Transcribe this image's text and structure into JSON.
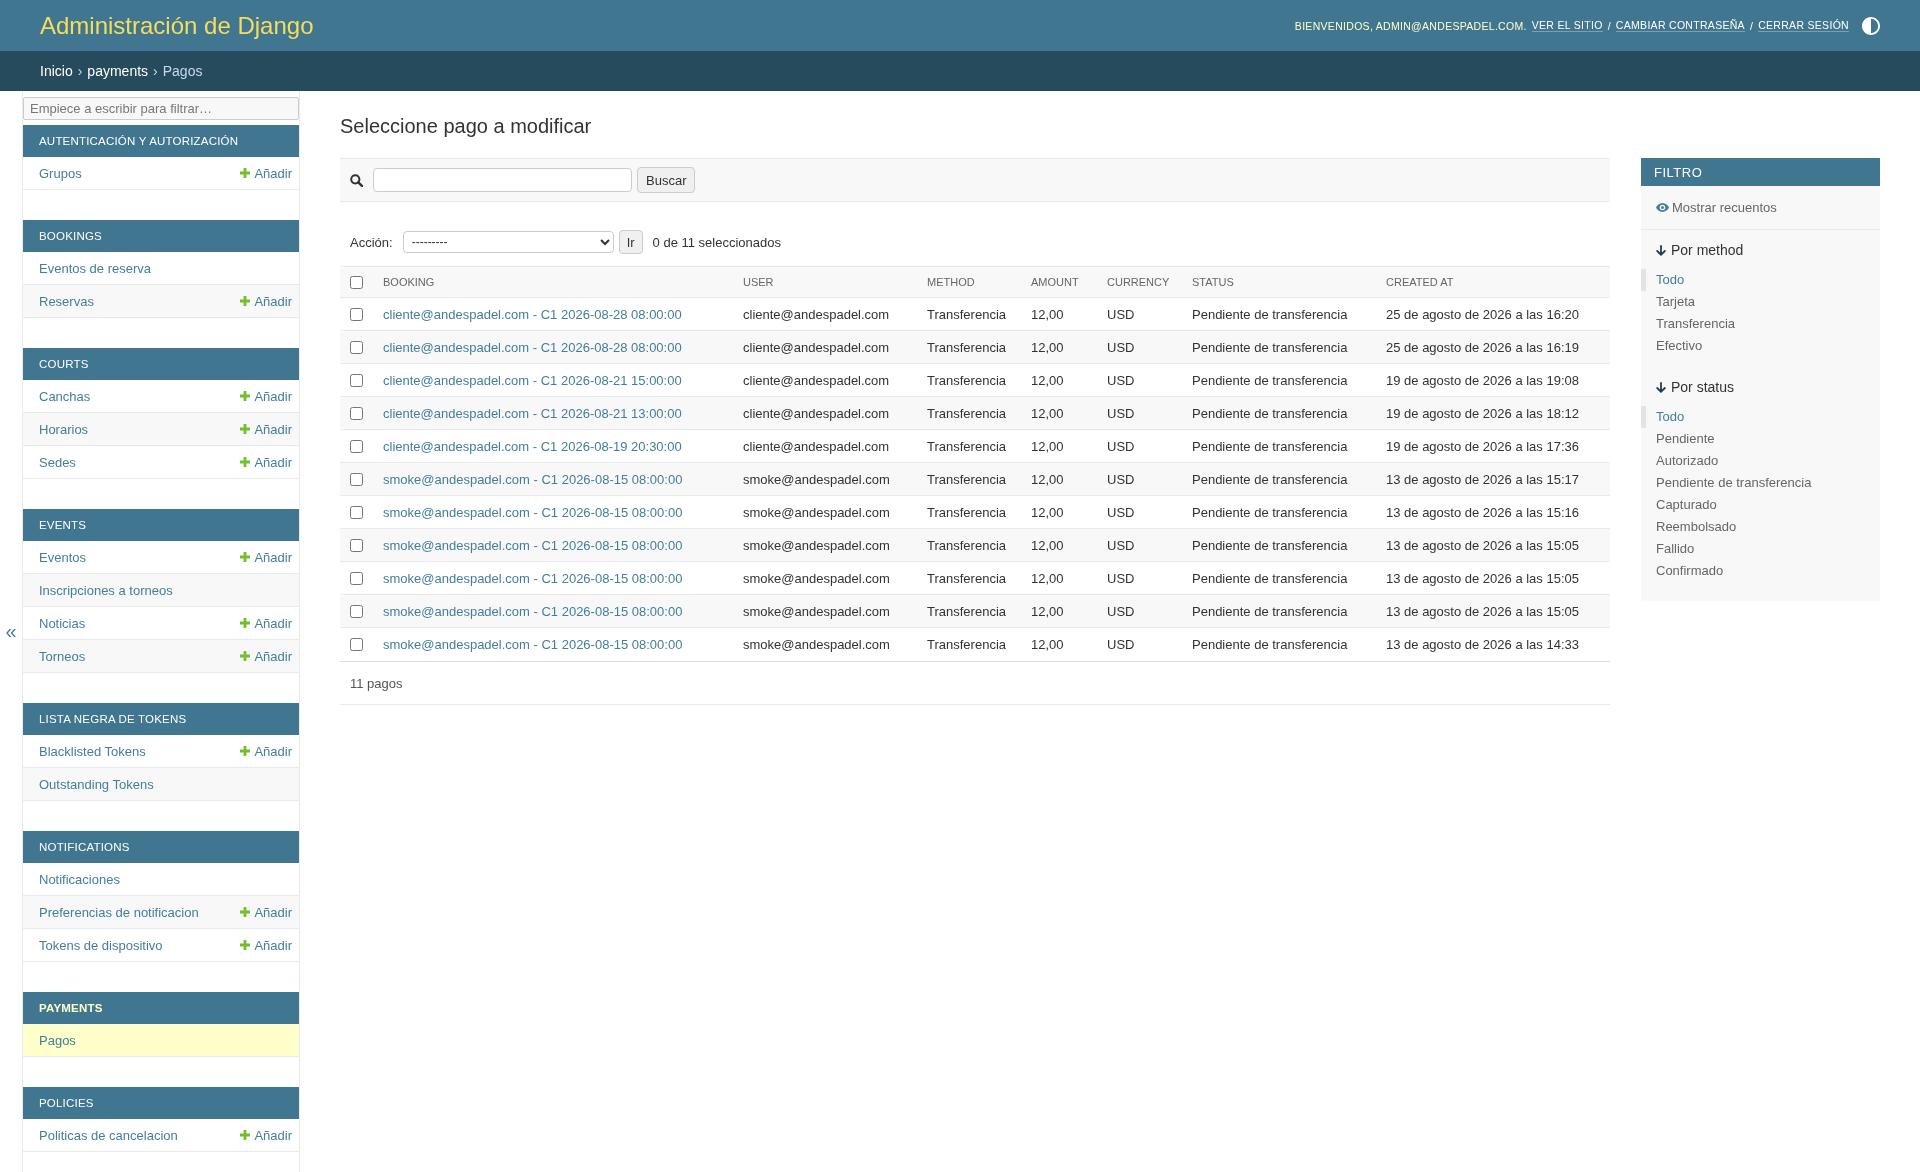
{
  "header": {
    "branding": "Administración de Django",
    "user_tools": [
      {
        "kind": "text",
        "text": "BIENVENIDOS, ADMIN@ANDESPADEL.COM."
      },
      {
        "kind": "link",
        "text": "VER EL SITIO"
      },
      {
        "kind": "separator",
        "text": "/"
      },
      {
        "kind": "link",
        "text": "CAMBIAR CONTRASEÑA"
      },
      {
        "kind": "separator",
        "text": "/"
      },
      {
        "kind": "link",
        "text": "CERRAR SESIÓN"
      }
    ]
  },
  "breadcrumbs": [
    {
      "kind": "link",
      "text": "Inicio"
    },
    {
      "kind": "separator",
      "text": "›"
    },
    {
      "kind": "link",
      "text": "payments"
    },
    {
      "kind": "separator",
      "text": "›"
    },
    {
      "kind": "current",
      "text": "Pagos"
    }
  ],
  "sidebar": {
    "toggle": "«",
    "filter_placeholder": "Empiece a escribir para filtrar…",
    "modules": [
      {
        "caption": "AUTENTICACIÓN Y AUTORIZACIÓN",
        "selected": false,
        "items": [
          {
            "label": "Grupos",
            "add": "Añadir",
            "selected": false
          }
        ]
      },
      {
        "caption": "BOOKINGS",
        "selected": false,
        "items": [
          {
            "label": "Eventos de reserva",
            "selected": false
          },
          {
            "label": "Reservas",
            "add": "Añadir",
            "selected": false
          }
        ]
      },
      {
        "caption": "COURTS",
        "selected": false,
        "items": [
          {
            "label": "Canchas",
            "add": "Añadir",
            "selected": false
          },
          {
            "label": "Horarios",
            "add": "Añadir",
            "selected": false
          },
          {
            "label": "Sedes",
            "add": "Añadir",
            "selected": false
          }
        ]
      },
      {
        "caption": "EVENTS",
        "selected": false,
        "items": [
          {
            "label": "Eventos",
            "add": "Añadir",
            "selected": false
          },
          {
            "label": "Inscripciones a torneos",
            "selected": false
          },
          {
            "label": "Noticias",
            "add": "Añadir",
            "selected": false
          },
          {
            "label": "Torneos",
            "add": "Añadir",
            "selected": false
          }
        ]
      },
      {
        "caption": "LISTA NEGRA DE TOKENS",
        "selected": false,
        "items": [
          {
            "label": "Blacklisted Tokens",
            "add": "Añadir",
            "selected": false
          },
          {
            "label": "Outstanding Tokens",
            "selected": false
          }
        ]
      },
      {
        "caption": "NOTIFICATIONS",
        "selected": false,
        "items": [
          {
            "label": "Notificaciones",
            "selected": false
          },
          {
            "label": "Preferencias de notificacion",
            "add": "Añadir",
            "selected": false
          },
          {
            "label": "Tokens de dispositivo",
            "add": "Añadir",
            "selected": false
          }
        ]
      },
      {
        "caption": "PAYMENTS",
        "selected": true,
        "items": [
          {
            "label": "Pagos",
            "selected": true
          }
        ]
      },
      {
        "caption": "POLICIES",
        "selected": false,
        "items": [
          {
            "label": "Politicas de cancelacion",
            "add": "Añadir",
            "selected": false
          }
        ]
      }
    ]
  },
  "title": "Seleccione pago a modificar",
  "search": {
    "button": "Buscar"
  },
  "actions": {
    "label": "Acción:",
    "select_value": "---------",
    "button": "Ir",
    "counter": "0 de 11 seleccionados"
  },
  "table": {
    "select_all_checked": false,
    "columns": [
      "BOOKING",
      "USER",
      "METHOD",
      "AMOUNT",
      "CURRENCY",
      "STATUS",
      "CREATED AT"
    ],
    "rows": [
      {
        "checked": false,
        "cells": [
          "cliente@andespadel.com - C1 2026-08-28 08:00:00",
          "cliente@andespadel.com",
          "Transferencia",
          "12,00",
          "USD",
          "Pendiente de transferencia",
          "25 de agosto de 2026 a las 16:20"
        ]
      },
      {
        "checked": false,
        "cells": [
          "cliente@andespadel.com - C1 2026-08-28 08:00:00",
          "cliente@andespadel.com",
          "Transferencia",
          "12,00",
          "USD",
          "Pendiente de transferencia",
          "25 de agosto de 2026 a las 16:19"
        ]
      },
      {
        "checked": false,
        "cells": [
          "cliente@andespadel.com - C1 2026-08-21 15:00:00",
          "cliente@andespadel.com",
          "Transferencia",
          "12,00",
          "USD",
          "Pendiente de transferencia",
          "19 de agosto de 2026 a las 19:08"
        ]
      },
      {
        "checked": false,
        "cells": [
          "cliente@andespadel.com - C1 2026-08-21 13:00:00",
          "cliente@andespadel.com",
          "Transferencia",
          "12,00",
          "USD",
          "Pendiente de transferencia",
          "19 de agosto de 2026 a las 18:12"
        ]
      },
      {
        "checked": false,
        "cells": [
          "cliente@andespadel.com - C1 2026-08-19 20:30:00",
          "cliente@andespadel.com",
          "Transferencia",
          "12,00",
          "USD",
          "Pendiente de transferencia",
          "19 de agosto de 2026 a las 17:36"
        ]
      },
      {
        "checked": false,
        "cells": [
          "smoke@andespadel.com - C1 2026-08-15 08:00:00",
          "smoke@andespadel.com",
          "Transferencia",
          "12,00",
          "USD",
          "Pendiente de transferencia",
          "13 de agosto de 2026 a las 15:17"
        ]
      },
      {
        "checked": false,
        "cells": [
          "smoke@andespadel.com - C1 2026-08-15 08:00:00",
          "smoke@andespadel.com",
          "Transferencia",
          "12,00",
          "USD",
          "Pendiente de transferencia",
          "13 de agosto de 2026 a las 15:16"
        ]
      },
      {
        "checked": false,
        "cells": [
          "smoke@andespadel.com - C1 2026-08-15 08:00:00",
          "smoke@andespadel.com",
          "Transferencia",
          "12,00",
          "USD",
          "Pendiente de transferencia",
          "13 de agosto de 2026 a las 15:05"
        ]
      },
      {
        "checked": false,
        "cells": [
          "smoke@andespadel.com - C1 2026-08-15 08:00:00",
          "smoke@andespadel.com",
          "Transferencia",
          "12,00",
          "USD",
          "Pendiente de transferencia",
          "13 de agosto de 2026 a las 15:05"
        ]
      },
      {
        "checked": false,
        "cells": [
          "smoke@andespadel.com - C1 2026-08-15 08:00:00",
          "smoke@andespadel.com",
          "Transferencia",
          "12,00",
          "USD",
          "Pendiente de transferencia",
          "13 de agosto de 2026 a las 15:05"
        ]
      },
      {
        "checked": false,
        "cells": [
          "smoke@andespadel.com - C1 2026-08-15 08:00:00",
          "smoke@andespadel.com",
          "Transferencia",
          "12,00",
          "USD",
          "Pendiente de transferencia",
          "13 de agosto de 2026 a las 14:33"
        ]
      }
    ]
  },
  "paginator": "11 pagos",
  "filter": {
    "title": "FILTRO",
    "show_counts": "Mostrar recuentos",
    "groups": [
      {
        "title": "Por method",
        "expanded": true,
        "choices": [
          {
            "label": "Todo",
            "selected": true
          },
          {
            "label": "Tarjeta",
            "selected": false
          },
          {
            "label": "Transferencia",
            "selected": false
          },
          {
            "label": "Efectivo",
            "selected": false
          }
        ]
      },
      {
        "title": "Por status",
        "expanded": true,
        "choices": [
          {
            "label": "Todo",
            "selected": true
          },
          {
            "label": "Pendiente",
            "selected": false
          },
          {
            "label": "Autorizado",
            "selected": false
          },
          {
            "label": "Pendiente de transferencia",
            "selected": false
          },
          {
            "label": "Capturado",
            "selected": false
          },
          {
            "label": "Reembolsado",
            "selected": false
          },
          {
            "label": "Fallido",
            "selected": false
          },
          {
            "label": "Confirmado",
            "selected": false
          }
        ]
      }
    ]
  }
}
